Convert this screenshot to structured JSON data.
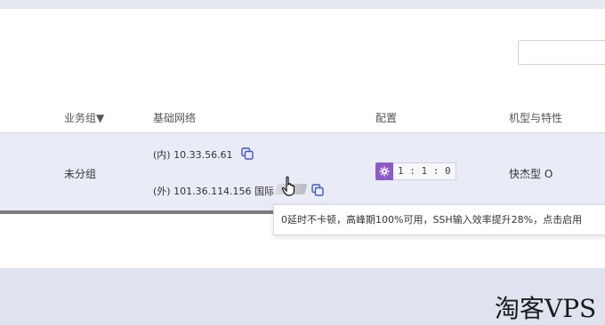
{
  "table": {
    "headers": [
      "业务组▼",
      "基础网络",
      "配置",
      "机型与特性"
    ],
    "row": {
      "group": "未分组",
      "ip_internal": "(内) 10.33.56.61",
      "ip_external": "(外) 101.36.114.156 国际",
      "config": "1 : 1 : 0",
      "machine_type": "快杰型 O"
    }
  },
  "tooltip": {
    "text": "0延时不卡顿，高峰期100%可用，SSH输入效率提升28%，点击启用"
  },
  "watermark": {
    "text": "淘客VPS"
  },
  "colors": {
    "row_bg": "#e9ebf7",
    "badge": "#8c5bc7",
    "copy_icon": "#3f59c8"
  }
}
